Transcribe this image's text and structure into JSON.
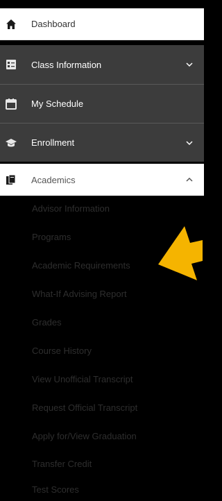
{
  "nav": {
    "dashboard": "Dashboard",
    "class_information": "Class Information",
    "my_schedule": "My Schedule",
    "enrollment": "Enrollment",
    "academics": "Academics"
  },
  "academics_items": [
    "Advisor Information",
    "Programs",
    "Academic Requirements",
    "What-If Advising Report",
    "Grades",
    "Course History",
    "View Unofficial Transcript",
    "Request Official Transcript",
    "Apply for/View Graduation",
    "Transfer Credit",
    "Test Scores"
  ],
  "colors": {
    "dark_bg": "#3c3c3c",
    "arrow": "#f5b400"
  }
}
